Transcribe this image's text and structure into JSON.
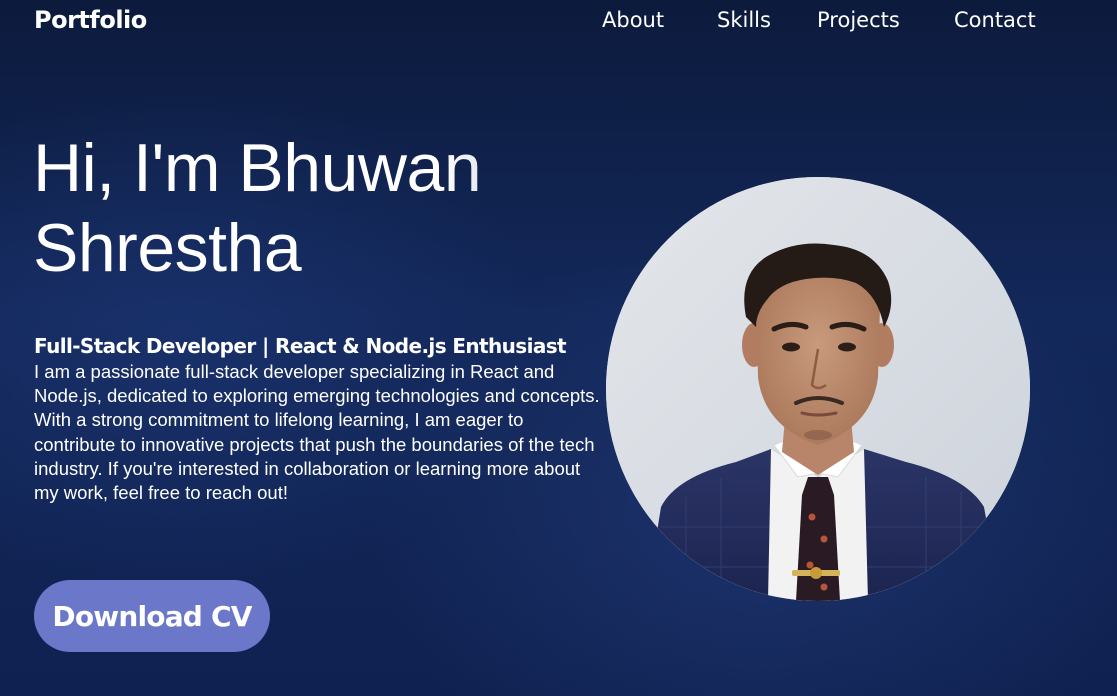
{
  "nav": {
    "brand": "Portfolio",
    "links": [
      {
        "label": "About"
      },
      {
        "label": "Skills"
      },
      {
        "label": "Projects"
      },
      {
        "label": "Contact"
      }
    ]
  },
  "hero": {
    "title_line1": "Hi, I'm Bhuwan",
    "title_line2": "Shrestha",
    "subtitle": "Full-Stack Developer | React & Node.js Enthusiast",
    "bio": "I am a passionate full-stack developer specializing in React and Node.js, dedicated to exploring emerging technologies and concepts. With a strong commitment to lifelong learning, I am eager to contribute to innovative projects that push the boundaries of the tech industry. If you're interested in collaboration or learning more about my work, feel free to reach out!",
    "cta_label": "Download CV"
  },
  "icons": {
    "profile_photo": "profile-photo"
  },
  "colors": {
    "background_dark": "#0c1a3c",
    "background_mid": "#13285a",
    "button": "#6b78c9",
    "text": "#ffffff"
  }
}
